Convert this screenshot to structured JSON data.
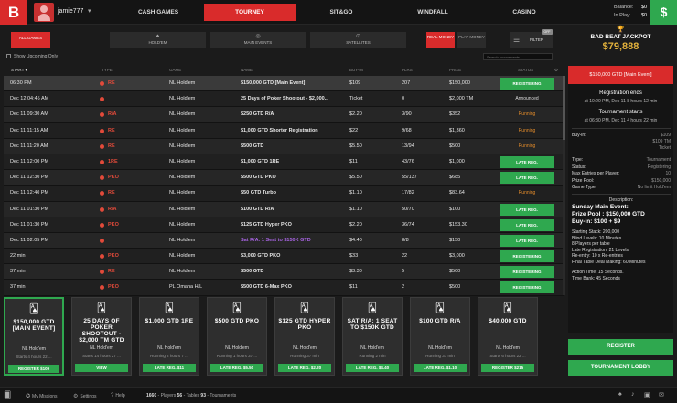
{
  "header": {
    "logo": "B",
    "username": "jamie777",
    "user_caret": "▾",
    "nav": [
      "CASH GAMES",
      "TOURNEY",
      "SIT&GO",
      "WINDFALL",
      "CASINO"
    ],
    "active_nav": "TOURNEY",
    "balance_label": "Balance:",
    "balance_value": "$0",
    "inplay_label": "In Play:",
    "inplay_value": "$0",
    "cashier_icon": "$"
  },
  "filters": {
    "tabs": [
      {
        "label": "ALL GAMES",
        "icon": ""
      },
      {
        "label": "HOLD'EM",
        "icon": "cards-icon"
      },
      {
        "label": "MAIN EVENTS",
        "icon": "target-icon"
      },
      {
        "label": "SATELLITES",
        "icon": "satellite-icon"
      }
    ],
    "money": [
      "REAL MONEY",
      "PLAY MONEY"
    ],
    "filter_label": "FILTER",
    "off_badge": "OFF",
    "show_upcoming": "Show Upcoming Only",
    "search_placeholder": "Search tournaments"
  },
  "table": {
    "columns": [
      "START",
      "TYPE",
      "GAME",
      "NAME",
      "BUY-IN",
      "PLRS",
      "PRIZE",
      "STATUS"
    ],
    "rows": [
      {
        "start": "06:30 PM",
        "type": "RE",
        "game": "NL Hold'em",
        "name": "$150,000 GTD [Main Event]",
        "buyin": "$109",
        "plrs": "207",
        "prize": "$150,000",
        "status": "REGISTERING",
        "kind": "green"
      },
      {
        "start": "Dec 12 04:45 AM",
        "type": "",
        "game": "NL Hold'em",
        "name": "25 Days of Poker Shootout - $2,000...",
        "buyin": "Ticket",
        "plrs": "0",
        "prize": "$2,000 TM",
        "status": "Announced",
        "kind": "announced"
      },
      {
        "start": "Dec 11 09:30 AM",
        "type": "R/A",
        "game": "NL Hold'em",
        "name": "$250 GTD R/A",
        "buyin": "$2.20",
        "plrs": "3/90",
        "prize": "$352",
        "status": "Running",
        "kind": "running"
      },
      {
        "start": "Dec 11 11:15 AM",
        "type": "RE",
        "game": "NL Hold'em",
        "name": "$1,000 GTD Shorter Registration",
        "buyin": "$22",
        "plrs": "9/68",
        "prize": "$1,360",
        "status": "Running",
        "kind": "running"
      },
      {
        "start": "Dec 11 11:20 AM",
        "type": "RE",
        "game": "NL Hold'em",
        "name": "$500 GTD",
        "buyin": "$5.50",
        "plrs": "13/94",
        "prize": "$500",
        "status": "Running",
        "kind": "running"
      },
      {
        "start": "Dec 11 12:00 PM",
        "type": "1RE",
        "game": "NL Hold'em",
        "name": "$1,000 GTD 1RE",
        "buyin": "$11",
        "plrs": "43/76",
        "prize": "$1,000",
        "status": "LATE REG.",
        "kind": "green"
      },
      {
        "start": "Dec 11 12:30 PM",
        "type": "PKO",
        "game": "NL Hold'em",
        "name": "$500 GTD PKO",
        "buyin": "$5.50",
        "plrs": "55/137",
        "prize": "$685",
        "status": "LATE REG.",
        "kind": "green"
      },
      {
        "start": "Dec 11 12:40 PM",
        "type": "RE",
        "game": "NL Hold'em",
        "name": "$50 GTD Turbo",
        "buyin": "$1.10",
        "plrs": "17/82",
        "prize": "$83.64",
        "status": "Running",
        "kind": "running"
      },
      {
        "start": "Dec 11 01:30 PM",
        "type": "R/A",
        "game": "NL Hold'em",
        "name": "$100 GTD R/A",
        "buyin": "$1.10",
        "plrs": "50/70",
        "prize": "$100",
        "status": "LATE REG.",
        "kind": "green"
      },
      {
        "start": "Dec 11 01:30 PM",
        "type": "PKO",
        "game": "NL Hold'em",
        "name": "$125 GTD Hyper PKO",
        "buyin": "$2.20",
        "plrs": "36/74",
        "prize": "$153.30",
        "status": "LATE REG.",
        "kind": "green"
      },
      {
        "start": "Dec 11 02:05 PM",
        "type": "",
        "game": "NL Hold'em",
        "name": "Sat R/A: 1 Seat to $150K GTD",
        "buyin": "$4.40",
        "plrs": "8/8",
        "prize": "$150",
        "status": "LATE REG.",
        "kind": "green",
        "sat": true
      },
      {
        "start": "22 min",
        "type": "PKO",
        "game": "NL Hold'em",
        "name": "$3,000 GTD PKO",
        "buyin": "$33",
        "plrs": "22",
        "prize": "$3,000",
        "status": "REGISTERING",
        "kind": "green"
      },
      {
        "start": "37 min",
        "type": "RE",
        "game": "NL Hold'em",
        "name": "$500 GTD",
        "buyin": "$3.30",
        "plrs": "5",
        "prize": "$500",
        "status": "REGISTERING",
        "kind": "green"
      },
      {
        "start": "37 min",
        "type": "PKO",
        "game": "PL Omaha H/L",
        "name": "$500 GTD 6-Max PKO",
        "buyin": "$11",
        "plrs": "2",
        "prize": "$500",
        "status": "REGISTERING",
        "kind": "green"
      }
    ]
  },
  "cards": [
    {
      "title": "$150,000 GTD [MAIN EVENT]",
      "game": "NL Hold'em",
      "start": "Starts 4 hours 22 ...",
      "button": "REGISTER $109"
    },
    {
      "title": "25 DAYS OF POKER SHOOTOUT - $2,000 TM GTD",
      "game": "NL Hold'em",
      "start": "Starts 14 hours 27 ...",
      "button": "VIEW"
    },
    {
      "title": "$1,000 GTD 1RE",
      "game": "NL Hold'em",
      "start": "Running 2 hours 7 ...",
      "button": "LATE REG. $11"
    },
    {
      "title": "$500 GTD PKO",
      "game": "NL Hold'em",
      "start": "Running 1 hours 37 ...",
      "button": "LATE REG. $5.50"
    },
    {
      "title": "$125 GTD HYPER PKO",
      "game": "NL Hold'em",
      "start": "Running 37 min",
      "button": "LATE REG. $2.20"
    },
    {
      "title": "SAT R/A: 1 SEAT TO $150K GTD",
      "game": "NL Hold'em",
      "start": "Running 2 min",
      "button": "LATE REG. $4.40"
    },
    {
      "title": "$100 GTD R/A",
      "game": "NL Hold'em",
      "start": "Running 37 min",
      "button": "LATE REG. $1.10"
    },
    {
      "title": "$40,000 GTD",
      "game": "NL Hold'em",
      "start": "Starts 6 hours 22 ...",
      "button": "REGISTER $215"
    }
  ],
  "jackpot": {
    "title": "BAD BEAT JACKPOT",
    "value": "$79,888"
  },
  "details": {
    "title": "$150,000 GTD [Main Event]",
    "reg_ends_label": "Registration ends",
    "reg_ends_value": "at 10:20 PM, Dec 11 8 hours 12 min",
    "tstarts_label": "Tournament starts",
    "tstarts_value": "at 06:30 PM, Dec 11 4 hours 22 min",
    "buyin_label": "Buy-in:",
    "buyin_lines": [
      "$109",
      "$109 TM",
      "Ticket"
    ],
    "info": [
      {
        "k": "Type:",
        "v": "Tournament"
      },
      {
        "k": "Status:",
        "v": "Registering"
      },
      {
        "k": "Max Entries per Player:",
        "v": "10"
      },
      {
        "k": "Prize Pool:",
        "v": "$150,000"
      },
      {
        "k": "Game Type:",
        "v": "No limit Hold'em"
      }
    ],
    "desc_label": "Description:",
    "desc_big": [
      "Sunday Main Event:",
      "Prize Pool : $150,000 GTD",
      "Buy-In: $100 + $9"
    ],
    "desc_lines": [
      "Starting Stack: 200,000",
      "Blind Levels: 10 Minutes",
      "8 Players per table",
      "Late Registration: 21 Levels",
      "Re-entry: 10 x Re-entries",
      "Final Table Deal Making: 60 Minutes"
    ],
    "desc_lines2": [
      "Action Time: 15 Seconds.",
      "Time Bank: 45 Seconds"
    ],
    "register_label": "REGISTER",
    "lobby_label": "TOURNAMENT LOBBY"
  },
  "footer": {
    "missions": "My Missions",
    "settings": "Settings",
    "help": "Help",
    "players_count": "1660",
    "players_label": "Players",
    "tables_count": "56",
    "tables_label": "Tables",
    "tourneys_count": "93",
    "tourneys_label": "Tournaments"
  }
}
